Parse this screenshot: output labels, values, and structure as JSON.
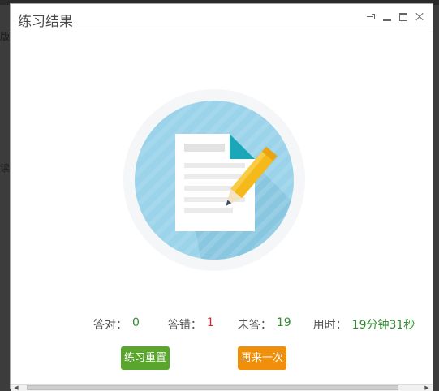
{
  "window": {
    "title": "练习结果",
    "controls": [
      "pin-icon",
      "minimize-icon",
      "maximize-icon",
      "close-icon"
    ]
  },
  "background_fragments": [
    "版",
    "读"
  ],
  "stats": [
    {
      "label": "答对：",
      "value": "0",
      "color": "#2e8b2e"
    },
    {
      "label": "答错：",
      "value": "1",
      "color": "#d42a2a"
    },
    {
      "label": "未答：",
      "value": "19",
      "color": "#2e8b2e"
    },
    {
      "label": "用时：",
      "value": "19分钟31秒",
      "color": "#2e8b2e"
    }
  ],
  "buttons": {
    "reset_label": "练习重置",
    "again_label": "再来一次"
  },
  "colors": {
    "circle": "#9ad3ea",
    "ring": "#f5f6f8",
    "pencil": "#f6b91a",
    "reset_btn": "#5aa52b",
    "again_btn": "#f0900a"
  }
}
